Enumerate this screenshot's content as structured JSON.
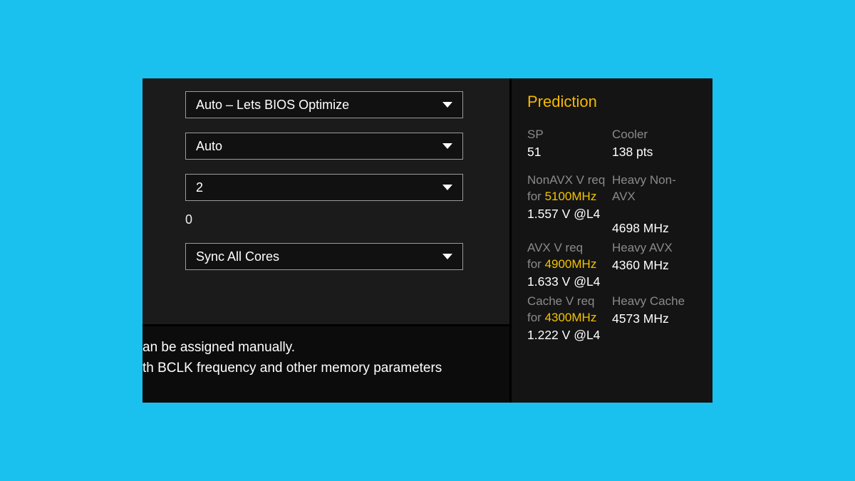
{
  "left": {
    "select1": "Auto – Lets BIOS Optimize",
    "select2": "Auto",
    "select3": "2",
    "static": "0",
    "select4": "Sync All Cores",
    "help_line1": "an be assigned manually.",
    "help_line2": "th BCLK frequency and other memory parameters"
  },
  "prediction": {
    "title": "Prediction",
    "sp": {
      "label": "SP",
      "value": "51"
    },
    "cooler": {
      "label": "Cooler",
      "value": "138 pts"
    },
    "nonavx": {
      "label_a": "NonAVX V req",
      "label_b": "for ",
      "freq": "5100MHz",
      "voltage": "1.557 V @L4",
      "heavy_label": "Heavy Non-AVX",
      "heavy_value": "4698 MHz"
    },
    "avx": {
      "label_a": "AVX V req",
      "label_b": "for ",
      "freq": "4900MHz",
      "voltage": "1.633 V @L4",
      "heavy_label": "Heavy AVX",
      "heavy_value": "4360 MHz"
    },
    "cache": {
      "label_a": "Cache V req",
      "label_b": "for ",
      "freq": "4300MHz",
      "voltage": "1.222 V @L4",
      "heavy_label": "Heavy Cache",
      "heavy_value": "4573 MHz"
    }
  }
}
